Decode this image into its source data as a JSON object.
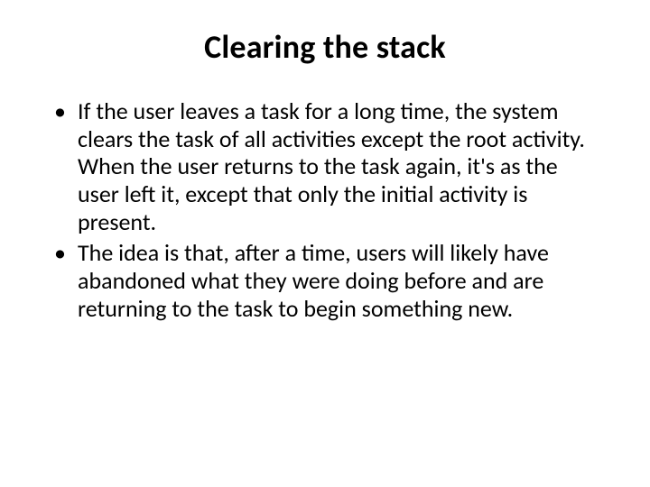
{
  "slide": {
    "title": "Clearing the stack",
    "bullets": [
      "If the user leaves a task for a long time, the system clears the task of all activities except the root activity. When the user returns to the task again, it's as the user left it, except that only the initial activity is present.",
      "The idea is that, after a time, users will likely have abandoned what they were doing before and are returning to the task to begin something new."
    ]
  }
}
